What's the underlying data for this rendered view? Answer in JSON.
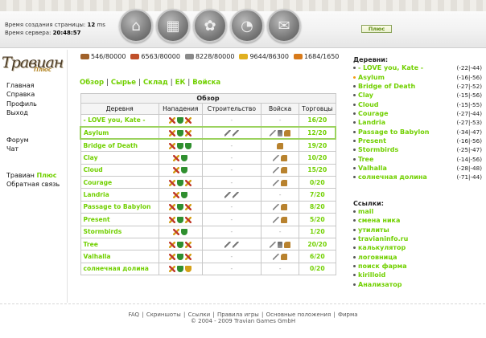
{
  "server": {
    "page_time_label": "Время создания страницы:",
    "page_time_value": "12",
    "page_time_unit": "ms",
    "server_time_label": "Время сервера:",
    "server_time_value": "20:48:57"
  },
  "plus_button": "Плюс",
  "logo": {
    "text": "Травиан",
    "sub": "Плюс"
  },
  "left_nav": {
    "group1": [
      "Главная",
      "Справка",
      "Профиль",
      "Выход"
    ],
    "group2": [
      "Форум",
      "Чат"
    ],
    "travian_plus_prefix": "Травиан",
    "travian_plus_suffix": "Плюс",
    "feedback": "Обратная связь"
  },
  "resources": [
    {
      "name": "wood",
      "value": "546/80000",
      "color": "#a0612a"
    },
    {
      "name": "clay",
      "value": "6563/80000",
      "color": "#c0502a"
    },
    {
      "name": "iron",
      "value": "8228/80000",
      "color": "#8a8a8a"
    },
    {
      "name": "crop",
      "value": "9644/86300",
      "color": "#e0b020"
    },
    {
      "name": "crop-consumption",
      "value": "1684/1650",
      "color": "#d87a1a"
    }
  ],
  "tabs": [
    "Обзор",
    "Сырье",
    "Склад",
    "ЕК",
    "Войска"
  ],
  "table": {
    "caption": "Обзор",
    "headers": [
      "Деревня",
      "Нападения",
      "Строительство",
      "Войска",
      "Торговцы"
    ],
    "rows": [
      {
        "village": "- LOVE you, Kate -",
        "attacks": "x,sh,x",
        "build": "-",
        "troops": "-",
        "traders": "16/20",
        "active": false
      },
      {
        "village": "Asylum",
        "attacks": "x,sh,x",
        "build": "hm,hm",
        "troops": "sw,bt,hs",
        "traders": "12/20",
        "active": true
      },
      {
        "village": "Bridge of Death",
        "attacks": "x,sh,sh",
        "build": "-",
        "troops": "hs",
        "traders": "19/20",
        "active": false
      },
      {
        "village": "Clay",
        "attacks": "x,sh",
        "build": "-",
        "troops": "sw,hs",
        "traders": "10/20",
        "active": false
      },
      {
        "village": "Cloud",
        "attacks": "x,sh",
        "build": "-",
        "troops": "sw,hs",
        "traders": "15/20",
        "active": false
      },
      {
        "village": "Courage",
        "attacks": "x,sh,x",
        "build": "-",
        "troops": "sw,hs",
        "traders": "0/20",
        "active": false
      },
      {
        "village": "Landria",
        "attacks": "x,sh",
        "build": "hm,hm",
        "troops": "-",
        "traders": "7/20",
        "active": false
      },
      {
        "village": "Passage to Babylon",
        "attacks": "x,sh,x",
        "build": "-",
        "troops": "sw,hs",
        "traders": "8/20",
        "active": false
      },
      {
        "village": "Present",
        "attacks": "x,sh,x",
        "build": "-",
        "troops": "sw,hs",
        "traders": "5/20",
        "active": false
      },
      {
        "village": "Stormbirds",
        "attacks": "x,sh",
        "build": "-",
        "troops": "-",
        "traders": "1/20",
        "active": false
      },
      {
        "village": "Tree",
        "attacks": "x,sh,x",
        "build": "hm,hm",
        "troops": "sw,bt,hs",
        "traders": "20/20",
        "active": false
      },
      {
        "village": "Valhalla",
        "attacks": "x,sh,x",
        "build": "-",
        "troops": "sw,hs",
        "traders": "6/20",
        "active": false
      },
      {
        "village": "солнечная долина",
        "attacks": "x,sh,gold",
        "build": "-",
        "troops": "-",
        "traders": "0/20",
        "active": false
      }
    ]
  },
  "villages_panel": {
    "title": "Деревни:",
    "items": [
      {
        "name": "- LOVE you, Kate -",
        "coords": "(-22|-44)",
        "active": false
      },
      {
        "name": "Asylum",
        "coords": "(-16|-56)",
        "active": true
      },
      {
        "name": "Bridge of Death",
        "coords": "(-27|-52)",
        "active": false
      },
      {
        "name": "Clay",
        "coords": "(-15|-56)",
        "active": false
      },
      {
        "name": "Cloud",
        "coords": "(-15|-55)",
        "active": false
      },
      {
        "name": "Courage",
        "coords": "(-27|-44)",
        "active": false
      },
      {
        "name": "Landria",
        "coords": "(-27|-53)",
        "active": false
      },
      {
        "name": "Passage to Babylon",
        "coords": "(-34|-47)",
        "active": false
      },
      {
        "name": "Present",
        "coords": "(-16|-56)",
        "active": false
      },
      {
        "name": "Stormbirds",
        "coords": "(-25|-47)",
        "active": false
      },
      {
        "name": "Tree",
        "coords": "(-14|-56)",
        "active": false
      },
      {
        "name": "Valhalla",
        "coords": "(-28|-48)",
        "active": false
      },
      {
        "name": "солнечная долина",
        "coords": "(-71|-44)",
        "active": false
      }
    ]
  },
  "links_panel": {
    "title": "Ссылки:",
    "items": [
      "mail",
      "смена ника",
      "утилиты",
      "travianinfo.ru",
      "калькулятор",
      "логовница",
      "поиск фарма",
      "kirilloid",
      "Анализатор"
    ]
  },
  "footer": {
    "links": [
      "FAQ",
      "Скриншоты",
      "Ссылки",
      "Правила игры",
      "Основные положения",
      "Фирма"
    ],
    "copyright": "© 2004 - 2009 Travian Games GmbH"
  }
}
